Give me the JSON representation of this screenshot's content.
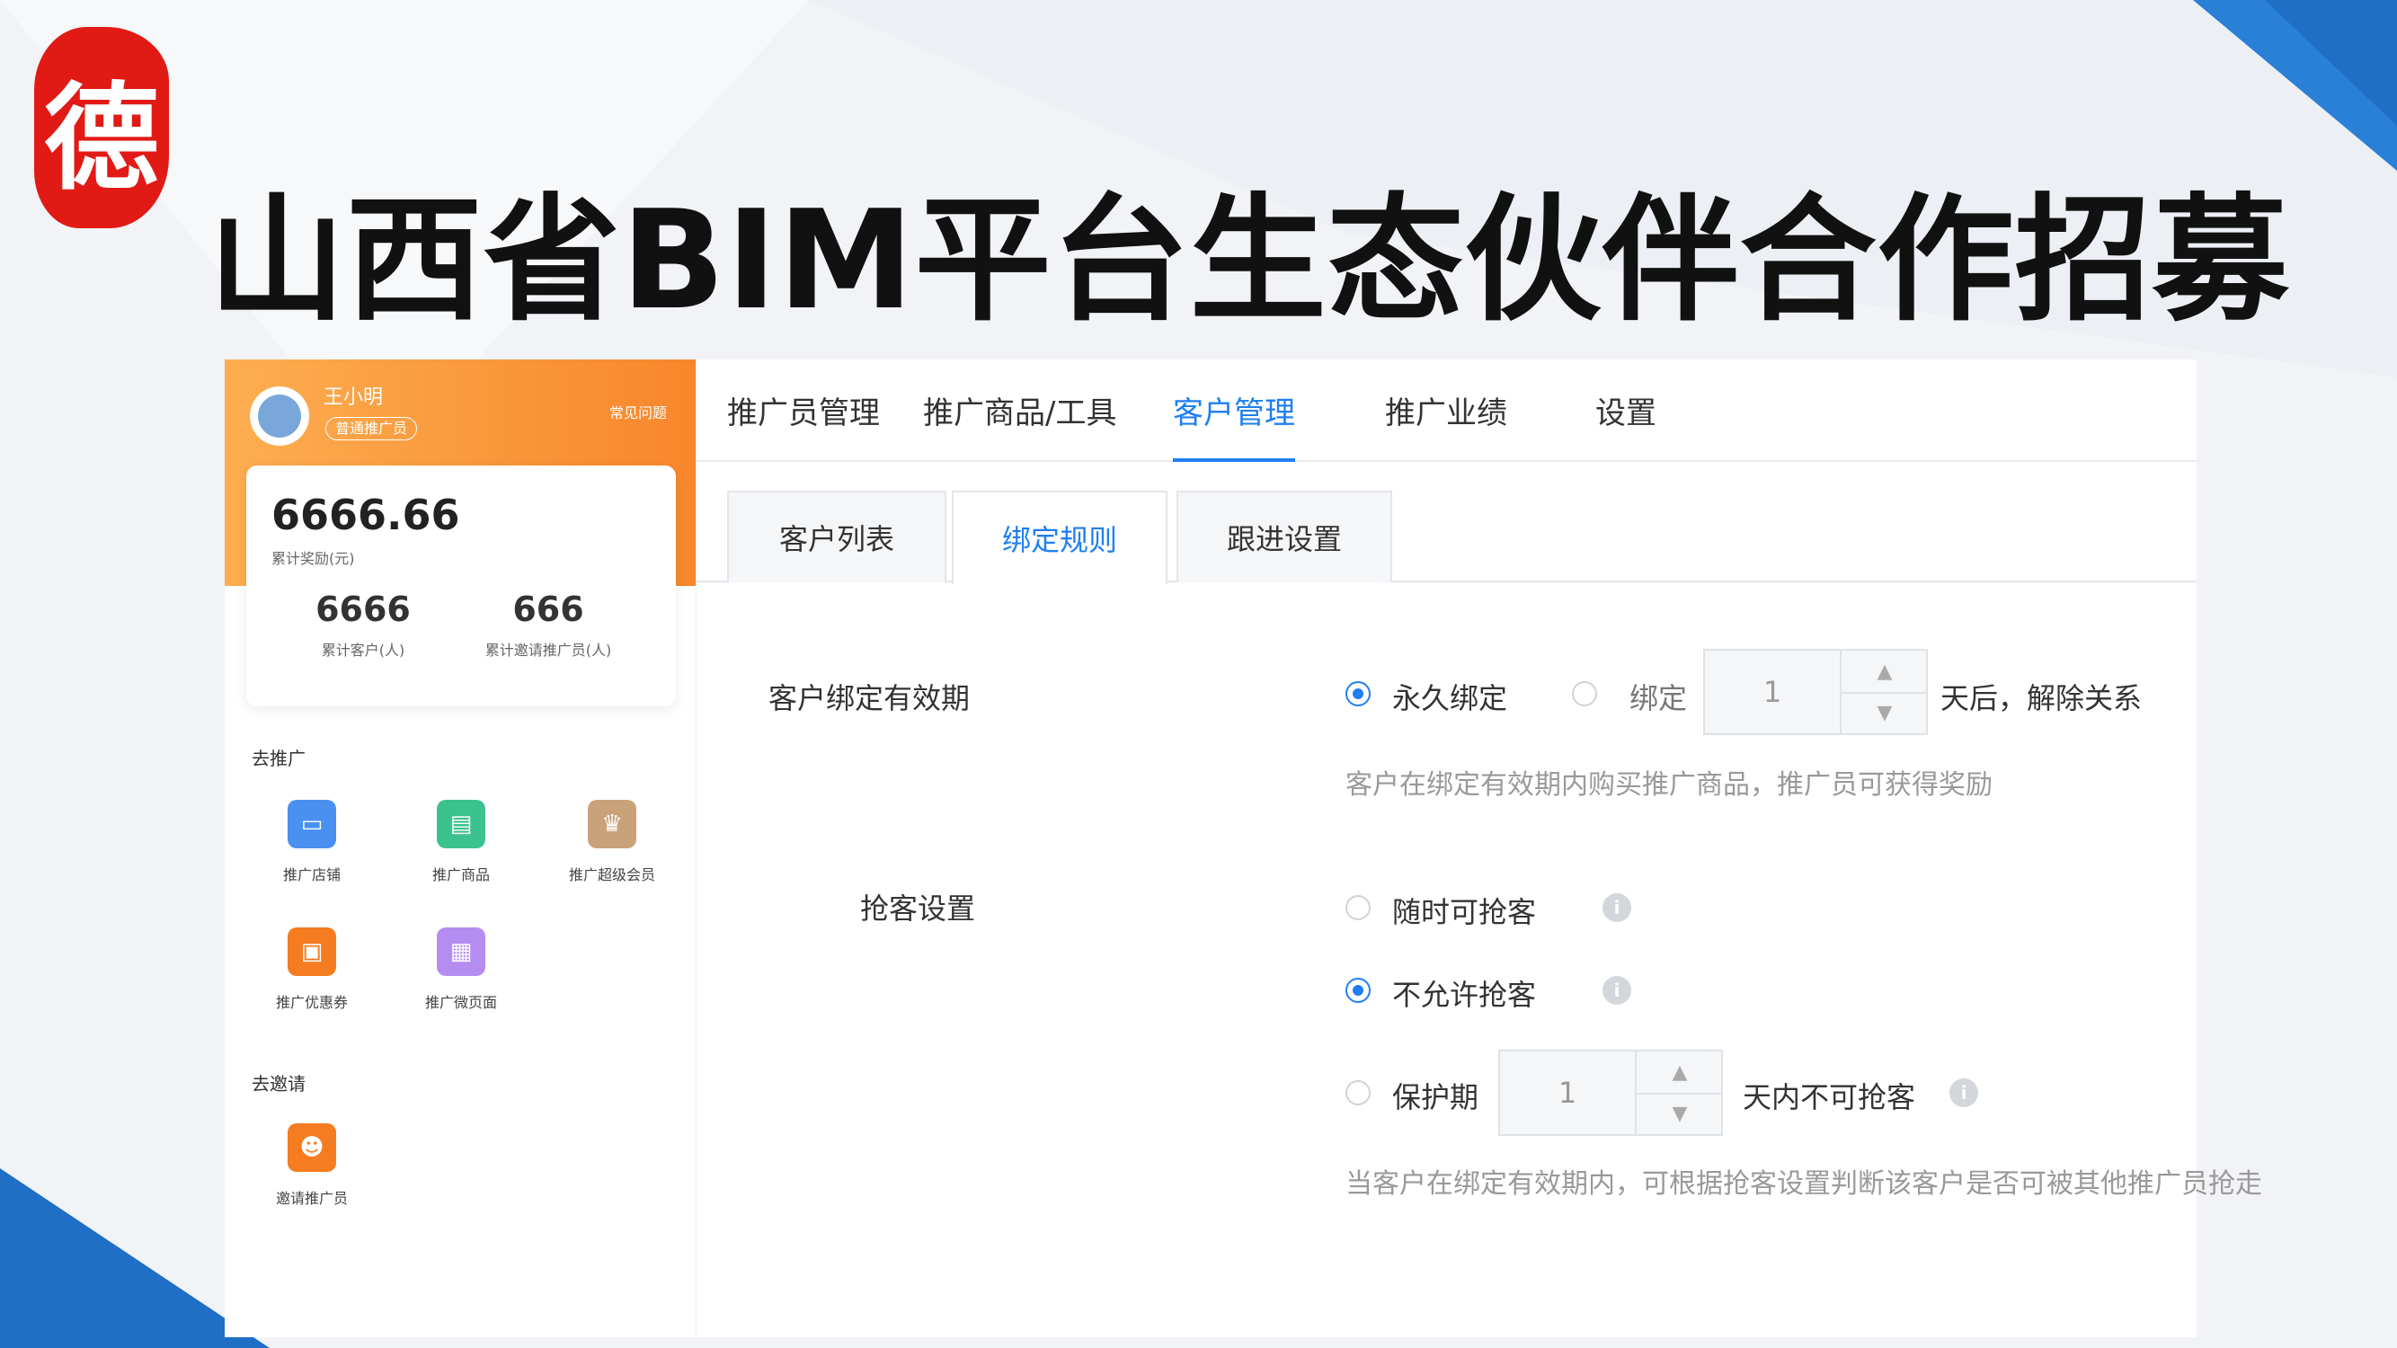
{
  "slide": {
    "title": "山西省BIM平台生态伙伴合作招募",
    "logo_text": "德",
    "colors": {
      "accent_blue": "#1f7ff2",
      "orange": "#f8862b",
      "seal_red": "#e11a15"
    }
  },
  "sidebar": {
    "user_name": "王小明",
    "user_badge": "普通推广员",
    "faq_link": "常见问题",
    "total_amount": "6666.66",
    "total_label": "累计奖励(元)",
    "stats": [
      {
        "value": "6666",
        "label": "累计客户(人)"
      },
      {
        "value": "666",
        "label": "累计邀请推广员(人)"
      }
    ],
    "promote_title": "去推广",
    "promote_tools": [
      {
        "label": "推广店铺",
        "icon": "shop-icon",
        "color": "#4a90f0"
      },
      {
        "label": "推广商品",
        "icon": "product-icon",
        "color": "#3cc28f"
      },
      {
        "label": "推广超级会员",
        "icon": "crown-icon",
        "color": "#c9a27a"
      },
      {
        "label": "推广优惠券",
        "icon": "coupon-icon",
        "color": "#f57c20"
      },
      {
        "label": "推广微页面",
        "icon": "page-icon",
        "color": "#b58cf0"
      }
    ],
    "invite_title": "去邀请",
    "invite_tools": [
      {
        "label": "邀请推广员",
        "icon": "invite-icon",
        "color": "#f57c20"
      }
    ]
  },
  "top_tabs": [
    "推广员管理",
    "推广商品/工具",
    "客户管理",
    "推广业绩",
    "设置"
  ],
  "active_top_tab": "客户管理",
  "sub_tabs": [
    "客户列表",
    "绑定规则",
    "跟进设置"
  ],
  "active_sub_tab": "绑定规则",
  "binding": {
    "label": "客户绑定有效期",
    "option_permanent": "永久绑定",
    "option_bind": "绑定",
    "days_value": "1",
    "days_suffix": "天后，解除关系",
    "help": "客户在绑定有效期内购买推广商品，推广员可获得奖励"
  },
  "grab": {
    "label": "抢客设置",
    "option_anytime": "随时可抢客",
    "option_disallow": "不允许抢客",
    "option_protect": "保护期",
    "protect_value": "1",
    "protect_suffix": "天内不可抢客",
    "help": "当客户在绑定有效期内，可根据抢客设置判断该客户是否可被其他推广员抢走"
  }
}
